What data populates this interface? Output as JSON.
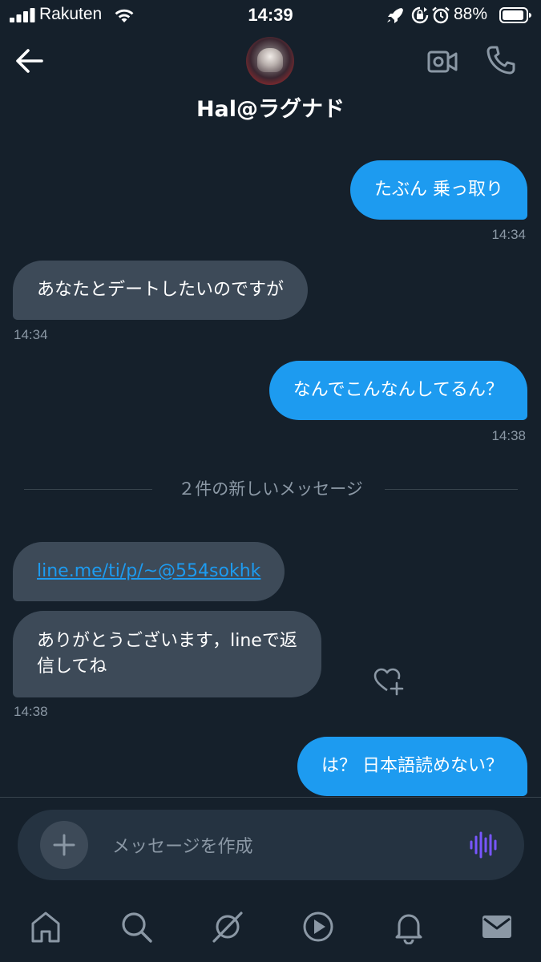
{
  "status_bar": {
    "carrier": "Rakuten",
    "time": "14:39",
    "battery_percent": "88%",
    "signal_bars": 4
  },
  "header": {
    "title": "Hal@ラグナド"
  },
  "messages": [
    {
      "side": "sent",
      "text": "たぶん 乗っ取り",
      "time": "14:34"
    },
    {
      "side": "received",
      "text": "あなたとデートしたいのですが",
      "time": "14:34"
    },
    {
      "side": "sent",
      "text": "なんでこんなんしてるん？",
      "time": "14:38"
    },
    {
      "side": "received",
      "text": "line.me/ti/p/~@554sokhk",
      "is_link": true
    },
    {
      "side": "received",
      "text_line1": "ありがとうございます，lineで返",
      "text_line2": "信してね",
      "time": "14:38"
    },
    {
      "side": "sent",
      "text": "は？ 日本語読めない？"
    }
  ],
  "divider": {
    "text": "２件の新しいメッセージ"
  },
  "composer": {
    "placeholder": "メッセージを作成"
  },
  "tabbar": {
    "items": [
      "home-icon",
      "search-icon",
      "spaces-icon",
      "play-icon",
      "bell-icon",
      "mail-icon"
    ]
  },
  "colors": {
    "background": "#15202b",
    "sent_bubble": "#1d9bf0",
    "received_bubble": "#3d4a58",
    "muted_text": "#8b98a5",
    "accent_voice": "#7856ff"
  }
}
